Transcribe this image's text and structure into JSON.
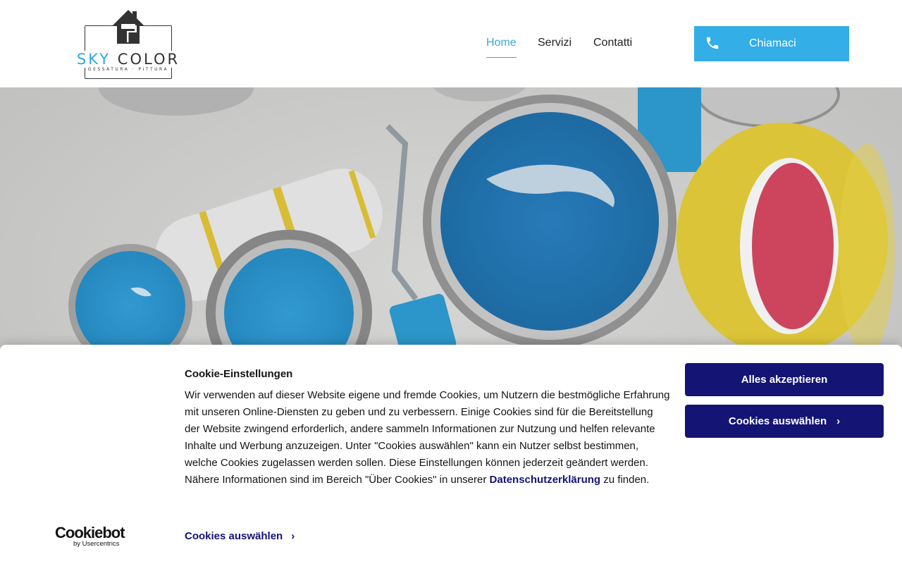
{
  "logo": {
    "text_part1": "SKY",
    "text_part2": "COLOR",
    "subtitle": "GESSATURA · PITTURA"
  },
  "nav": {
    "items": [
      {
        "label": "Home",
        "active": true
      },
      {
        "label": "Servizi",
        "active": false
      },
      {
        "label": "Contatti",
        "active": false
      }
    ]
  },
  "call_button": {
    "label": "Chiamaci",
    "icon": "phone-icon",
    "color": "#33aee6"
  },
  "hero": {
    "image": "paint-cans-and-rollers-photo"
  },
  "cookie_banner": {
    "title": "Cookie-Einstellungen",
    "body_before_link": "Wir verwenden auf dieser Website eigene und fremde Cookies, um Nutzern die bestmögliche Erfahrung mit unseren Online-Diensten zu geben und zu verbessern. Einige Cookies sind für die Bereitstellung der Website zwingend erforderlich, andere sammeln Informationen zur Nutzung und helfen relevante Inhalte und Werbung anzuzeigen. Unter \"Cookies auswählen\" kann ein Nutzer selbst bestimmen, welche Cookies zugelassen werden sollen. Diese Einstellungen können jederzeit geändert werden. Nähere Informationen sind im Bereich \"Über Cookies\" in unserer",
    "link_text": "Datenschutzerklärung",
    "body_after_link": "zu finden.",
    "accept_button": "Alles akzeptieren",
    "select_button": "Cookies auswählen",
    "select_link": "Cookies auswählen",
    "brand": "Cookiebot",
    "brand_by": "by Usercentrics",
    "button_color": "#141475"
  }
}
